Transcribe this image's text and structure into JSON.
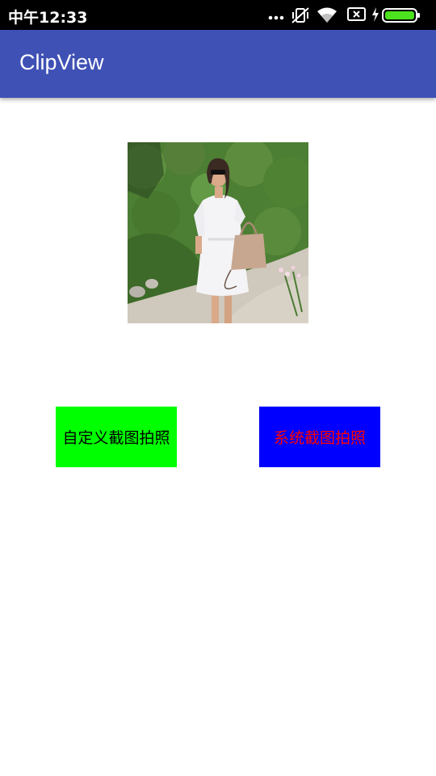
{
  "status_bar": {
    "time": "中午12:33",
    "icons": [
      "more-dots-icon",
      "vibrate-off-icon",
      "wifi-icon",
      "sim-x-icon",
      "charging-icon",
      "battery-icon"
    ]
  },
  "app_bar": {
    "title": "ClipView"
  },
  "image": {
    "description_icon": "photo-woman-white-dress"
  },
  "buttons": {
    "custom_crop": {
      "label": "自定义截图拍照",
      "bg": "#00FF00",
      "color": "#000000"
    },
    "system_crop": {
      "label": "系统截图拍照",
      "bg": "#0000FF",
      "color": "#FF0000"
    }
  },
  "colors": {
    "primary": "#3F51B5",
    "status": "#000000",
    "battery": "#4CE21E"
  }
}
